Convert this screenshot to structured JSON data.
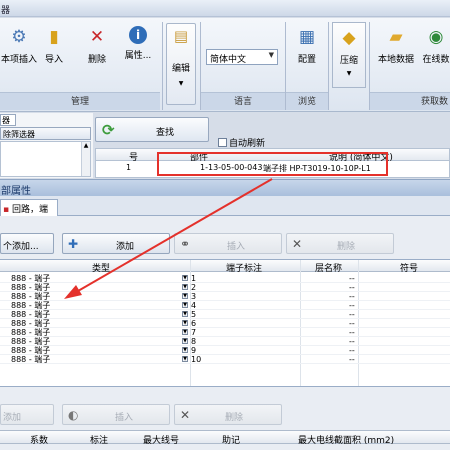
{
  "window": {
    "title_fragment": "器"
  },
  "ribbon": {
    "buttons": [
      {
        "label": "本项插入",
        "icon": "insert-items-icon",
        "color": "#4a78b5",
        "glyph": "⚙"
      },
      {
        "label": "导入",
        "icon": "database-import-icon",
        "color": "#d8a21c",
        "glyph": "▮"
      },
      {
        "label": "删除",
        "icon": "delete-icon",
        "color": "#c8262a",
        "glyph": "✕"
      },
      {
        "label": "属性...",
        "icon": "info-icon",
        "color": "#2f6db8",
        "glyph": "i"
      },
      {
        "label": "编辑",
        "icon": "edit-clipboard-icon",
        "color": "#c99a3a",
        "glyph": "▤"
      },
      {
        "label": "配置",
        "icon": "config-icon",
        "color": "#3a6fb0",
        "glyph": "▦"
      },
      {
        "label": "压缩",
        "icon": "compress-icon",
        "color": "#d8a21c",
        "glyph": "◆"
      },
      {
        "label": "本地数据",
        "icon": "folder-icon",
        "color": "#e0a92e",
        "glyph": "▰"
      },
      {
        "label": "在线数",
        "icon": "online-data-icon",
        "color": "#2f8a3a",
        "glyph": "◉"
      }
    ],
    "language_combo": "简体中文",
    "groups": [
      "管理",
      "语言",
      "浏览",
      "获取数"
    ]
  },
  "filter": {
    "tab": "器",
    "remove_filter": "除筛选器",
    "search_button": "查找",
    "auto_refresh": "自动刷新"
  },
  "result": {
    "headers": [
      "号",
      "部件",
      "说明 (简体中文)"
    ],
    "row": {
      "index": "1",
      "part": "1-13-05-00-043",
      "desc": "端子排 HP-T3019-10-10P-L1"
    }
  },
  "properties": {
    "title": "部属性",
    "tab": "回路，端子",
    "top_buttons": [
      {
        "label": "个添加...",
        "icon": "",
        "disabled": false
      },
      {
        "label": "添加",
        "icon": "add-icon",
        "disabled": false
      },
      {
        "label": "插入",
        "icon": "insert-icon",
        "disabled": true
      },
      {
        "label": "删除",
        "icon": "delete-icon",
        "disabled": true
      }
    ],
    "grid_headers": [
      "类型",
      "端子标注",
      "层名称",
      "符号"
    ],
    "rows": [
      {
        "type": "888 - 端子",
        "label": "1",
        "layer": "--"
      },
      {
        "type": "888 - 端子",
        "label": "2",
        "layer": "--"
      },
      {
        "type": "888 - 端子",
        "label": "3",
        "layer": "--"
      },
      {
        "type": "888 - 端子",
        "label": "4",
        "layer": "--"
      },
      {
        "type": "888 - 端子",
        "label": "5",
        "layer": "--"
      },
      {
        "type": "888 - 端子",
        "label": "6",
        "layer": "--"
      },
      {
        "type": "888 - 端子",
        "label": "7",
        "layer": "--"
      },
      {
        "type": "888 - 端子",
        "label": "8",
        "layer": "--"
      },
      {
        "type": "888 - 端子",
        "label": "9",
        "layer": "--"
      },
      {
        "type": "888 - 端子",
        "label": "10",
        "layer": "--"
      }
    ],
    "lower_buttons": [
      {
        "label": "添加",
        "disabled": true
      },
      {
        "label": "插入",
        "disabled": true
      },
      {
        "label": "删除",
        "disabled": true
      }
    ],
    "bottom_headers": [
      "系数",
      "标注",
      "最大线号",
      "助记",
      "最大电线截面积 (mm2)"
    ]
  },
  "annotation": {
    "color": "#e4312b"
  }
}
